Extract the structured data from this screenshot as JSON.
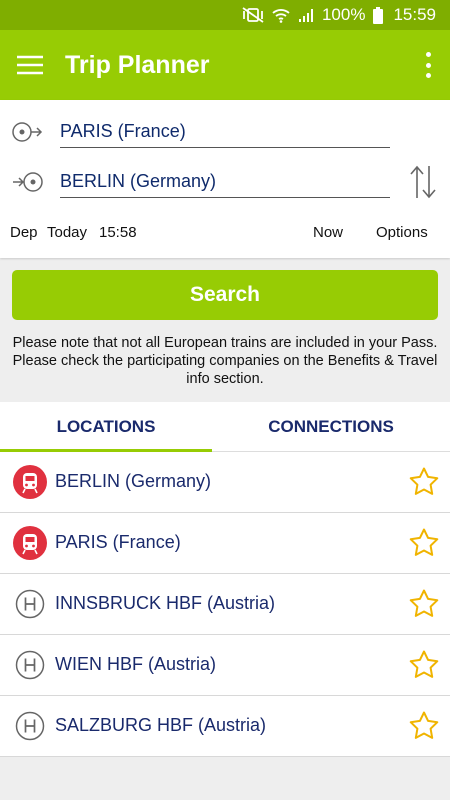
{
  "status_bar": {
    "battery": "100%",
    "time": "15:59",
    "icons": [
      "mute-vibrate-icon",
      "wifi-icon",
      "signal-icon",
      "battery-icon"
    ]
  },
  "app_bar": {
    "title": "Trip Planner",
    "menu_icon": "menu-icon",
    "overflow_icon": "more-vertical-icon"
  },
  "form": {
    "from": "PARIS (France)",
    "to": "BERLIN (Germany)",
    "dep_label": "Dep",
    "day": "Today",
    "time": "15:58",
    "now_label": "Now",
    "options_label": "Options"
  },
  "search_label": "Search",
  "note": "Please note that not all European trains are included in your Pass. Please check the participating companies on the Benefits & Travel info section.",
  "tabs": [
    {
      "label": "LOCATIONS",
      "active": true
    },
    {
      "label": "CONNECTIONS",
      "active": false
    }
  ],
  "locations": [
    {
      "name": "BERLIN (Germany)",
      "icon": "train-station-icon"
    },
    {
      "name": "PARIS (France)",
      "icon": "train-station-icon"
    },
    {
      "name": "INNSBRUCK HBF (Austria)",
      "icon": "stop-h-icon"
    },
    {
      "name": "WIEN HBF (Austria)",
      "icon": "stop-h-icon"
    },
    {
      "name": "SALZBURG HBF (Austria)",
      "icon": "stop-h-icon"
    }
  ],
  "colors": {
    "status_bar": "#7fae00",
    "primary": "#97cc04",
    "text_navy": "#1a2a6c",
    "station_red": "#e0313f",
    "star": "#f0b400"
  }
}
